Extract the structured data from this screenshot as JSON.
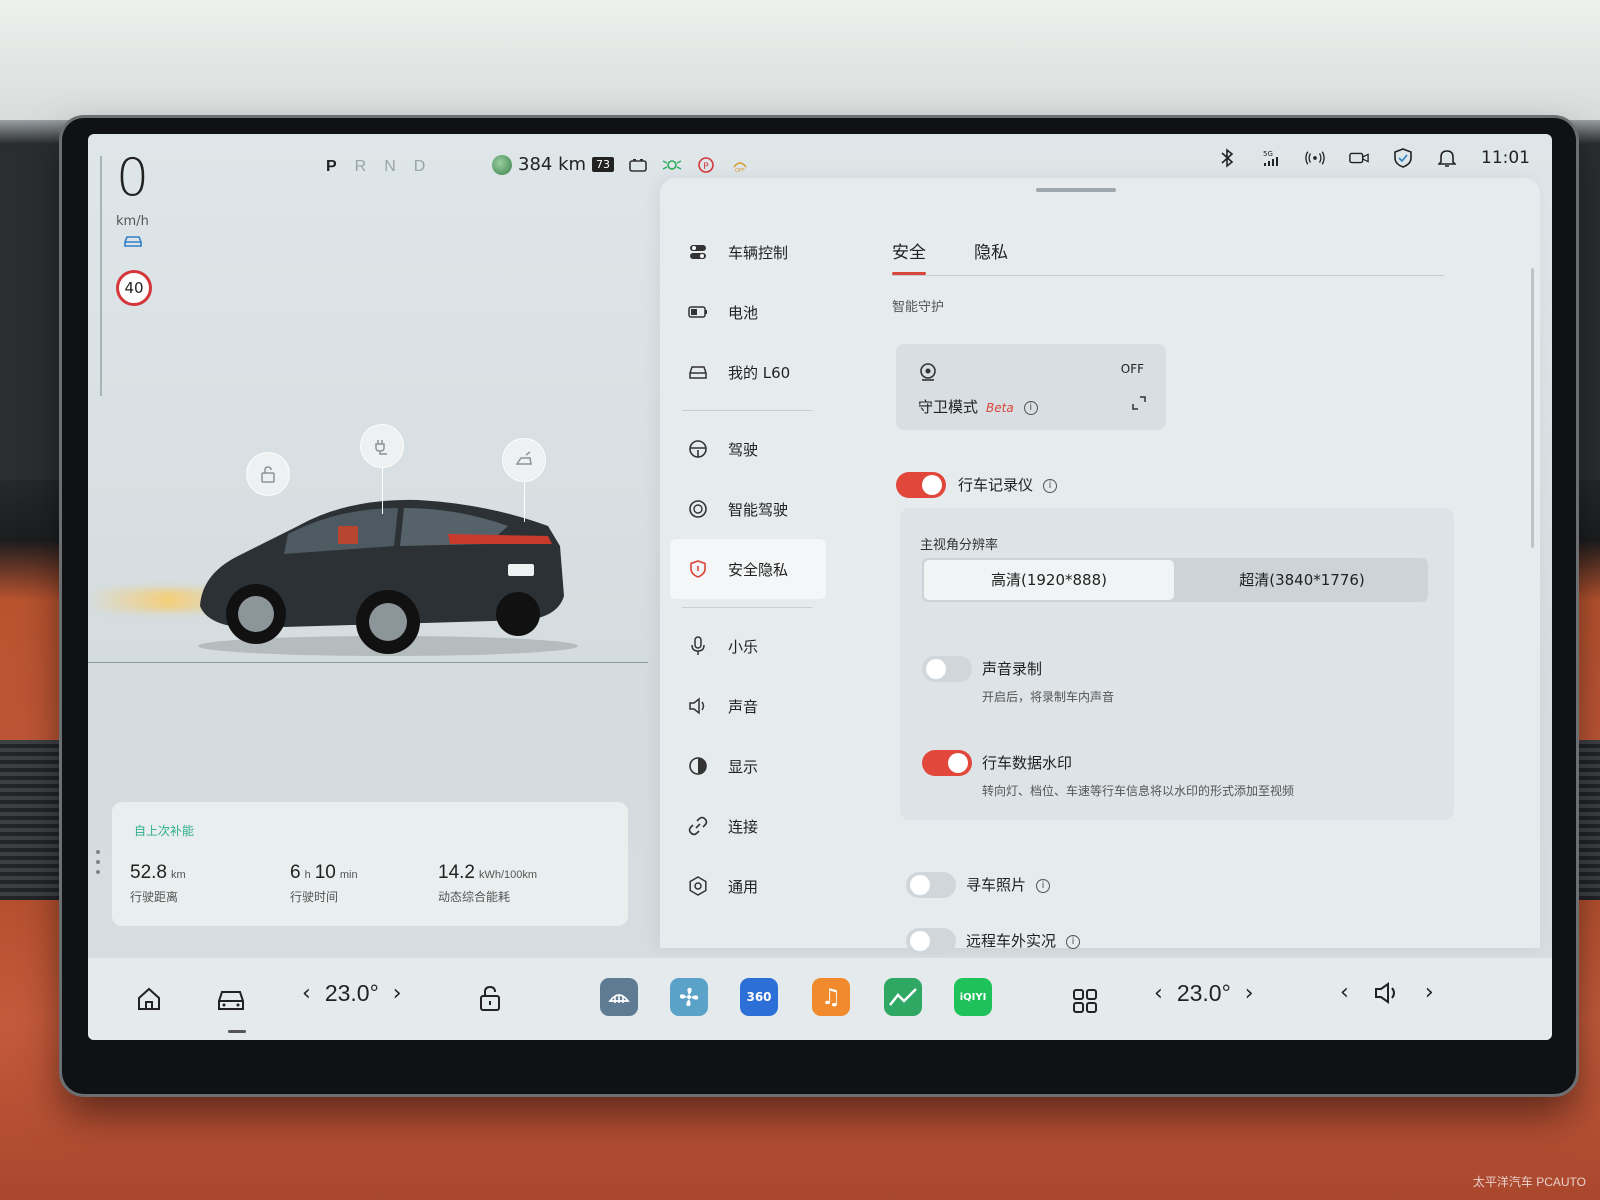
{
  "colors": {
    "accent": "#e1483b",
    "green": "#2fae8c"
  },
  "status": {
    "speed": "0",
    "speed_unit": "km/h",
    "speed_limit": "40",
    "gears": [
      "P",
      "R",
      "N",
      "D"
    ],
    "active_gear": "P",
    "range": "384 km",
    "battery_level": "73",
    "time": "11:01",
    "signal": "5G"
  },
  "trip": {
    "title": "自上次补能",
    "distance_value": "52.8",
    "distance_unit": "km",
    "distance_label": "行驶距离",
    "time_h": "6",
    "time_h_unit": "h",
    "time_m": "10",
    "time_m_unit": "min",
    "time_label": "行驶时间",
    "energy_value": "14.2",
    "energy_unit": "kWh/100km",
    "energy_label": "动态综合能耗"
  },
  "nav": {
    "items": [
      {
        "label": "车辆控制",
        "icon": "toggles-icon"
      },
      {
        "label": "电池",
        "icon": "battery-icon"
      },
      {
        "label": "我的 L60",
        "icon": "car-icon"
      },
      {
        "label": "驾驶",
        "icon": "steering-icon"
      },
      {
        "label": "智能驾驶",
        "icon": "assist-icon"
      },
      {
        "label": "安全隐私",
        "icon": "shield-icon"
      },
      {
        "label": "小乐",
        "icon": "mic-icon"
      },
      {
        "label": "声音",
        "icon": "speaker-icon"
      },
      {
        "label": "显示",
        "icon": "contrast-icon"
      },
      {
        "label": "连接",
        "icon": "link-icon"
      },
      {
        "label": "通用",
        "icon": "gear-icon"
      }
    ],
    "active": "安全隐私"
  },
  "tabs": [
    "安全",
    "隐私"
  ],
  "active_tab": "安全",
  "settings": {
    "section_title": "智能守护",
    "guard": {
      "label": "守卫模式",
      "badge": "Beta",
      "state": "OFF"
    },
    "dashcam": {
      "label": "行车记录仪",
      "on": true
    },
    "resolution": {
      "label": "主视角分辨率",
      "options": [
        "高清(1920*888)",
        "超清(3840*1776)"
      ],
      "selected": "高清(1920*888)"
    },
    "audio": {
      "label": "声音录制",
      "desc": "开启后，将录制车内声音",
      "on": false
    },
    "watermark": {
      "label": "行车数据水印",
      "desc": "转向灯、档位、车速等行车信息将以水印的形式添加至视频",
      "on": true
    },
    "find_car": {
      "label": "寻车照片",
      "on": false
    },
    "remote": {
      "label": "远程车外实况",
      "on": false
    }
  },
  "dock": {
    "left_temp": "23.0°",
    "right_temp": "23.0°",
    "apps": [
      {
        "name": "defrost-app",
        "label": "",
        "color": "#5f7b93"
      },
      {
        "name": "fan-app",
        "label": "",
        "color": "#5aa2c8"
      },
      {
        "name": "360-app",
        "label": "360",
        "color": "#2c6fd6"
      },
      {
        "name": "music-app",
        "label": "♫",
        "color": "#f08a2c"
      },
      {
        "name": "stocks-app",
        "label": "",
        "color": "#2fa864"
      },
      {
        "name": "iqiyi-app",
        "label": "iQIYI",
        "color": "#1fc25a"
      }
    ]
  },
  "watermark_text": "太平洋汽车 PCAUTO"
}
